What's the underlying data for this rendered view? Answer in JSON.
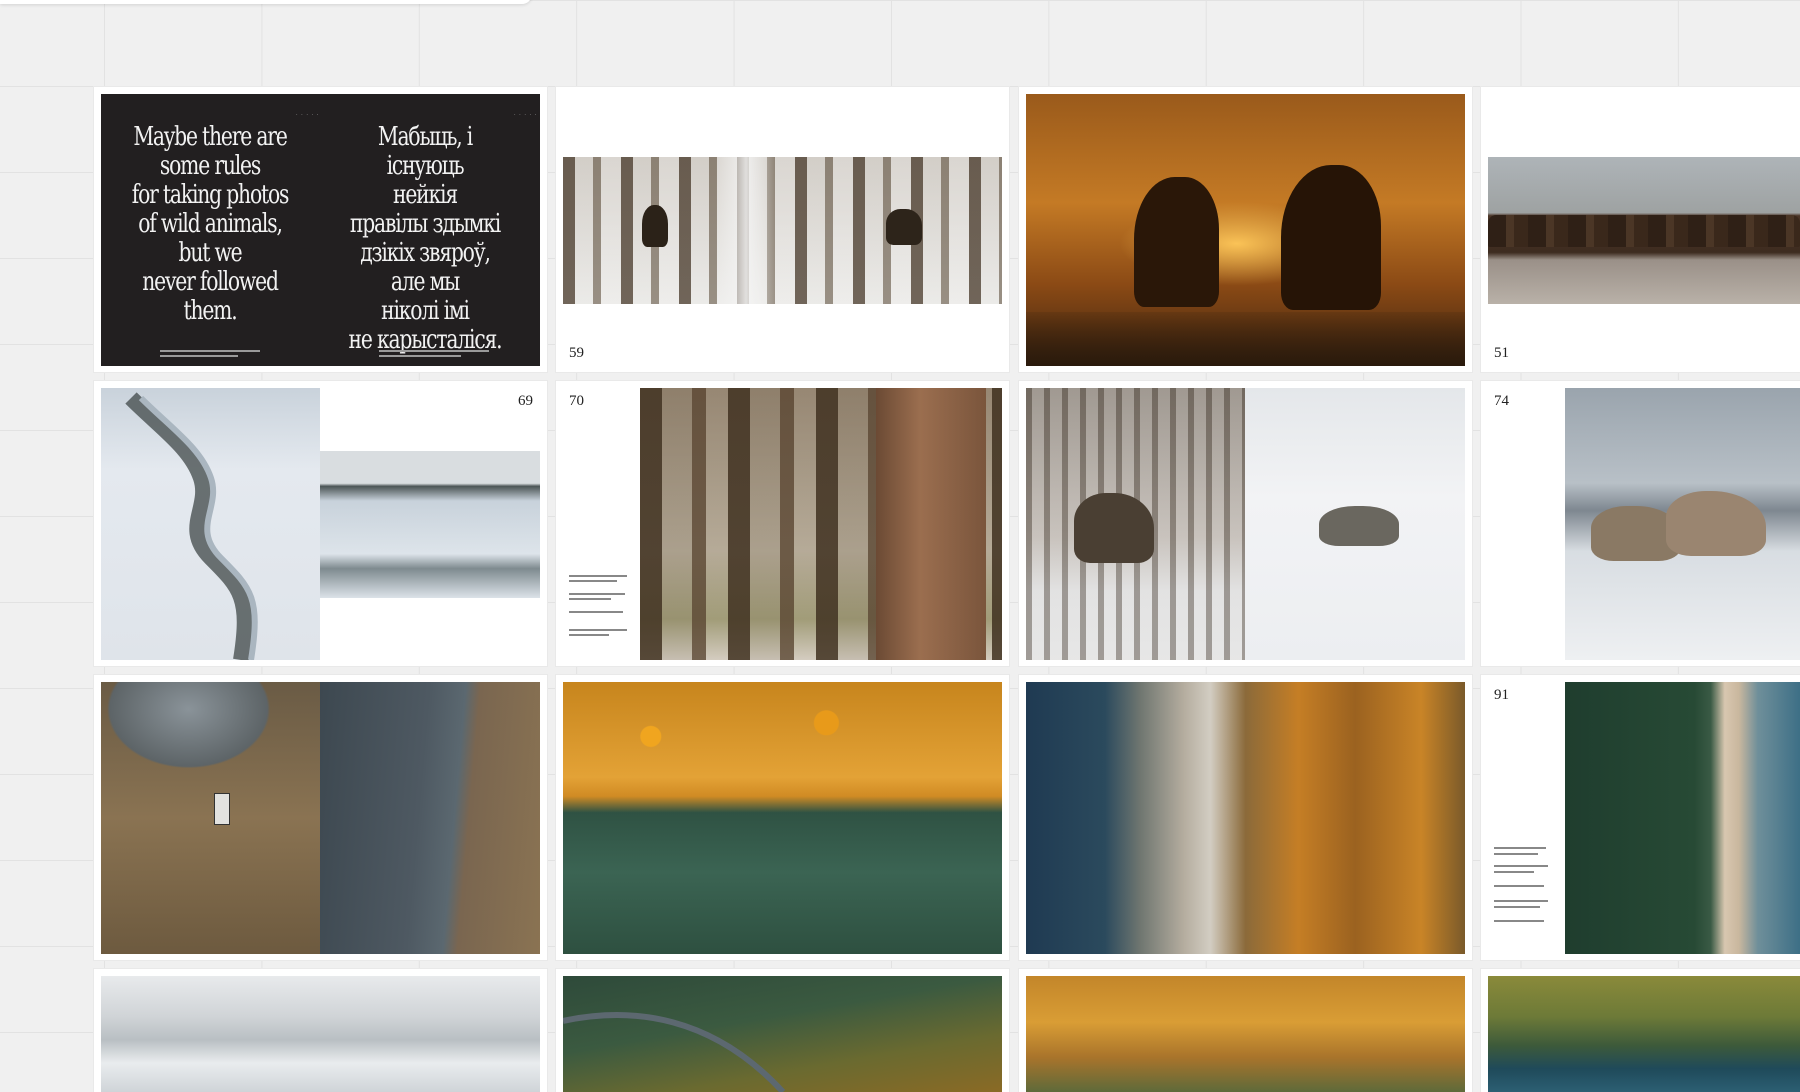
{
  "toolbar": {},
  "spreads": {
    "s1": {
      "quote_en": [
        "Maybe there are",
        "some rules",
        "for taking photos",
        "of wild animals,",
        "but we",
        "never followed",
        "them."
      ],
      "quote_be": [
        "Мабыць, і існуюць",
        "нейкія",
        "правілы здымкі",
        "дзікіх звяроў,",
        "але мы",
        "ніколі імі",
        "не карысталіся."
      ]
    },
    "s2": {
      "page": "59"
    },
    "s4": {
      "page": "51"
    },
    "s5": {
      "page": "69"
    },
    "s6": {
      "page": "70"
    },
    "s8": {
      "page": "74"
    },
    "s12": {
      "page": "91"
    }
  },
  "colors": {
    "canvas": "#f0f0f0",
    "grid": "#e2e2e2",
    "spread_bg": "#ffffff",
    "quote_bg": "#221f20"
  }
}
